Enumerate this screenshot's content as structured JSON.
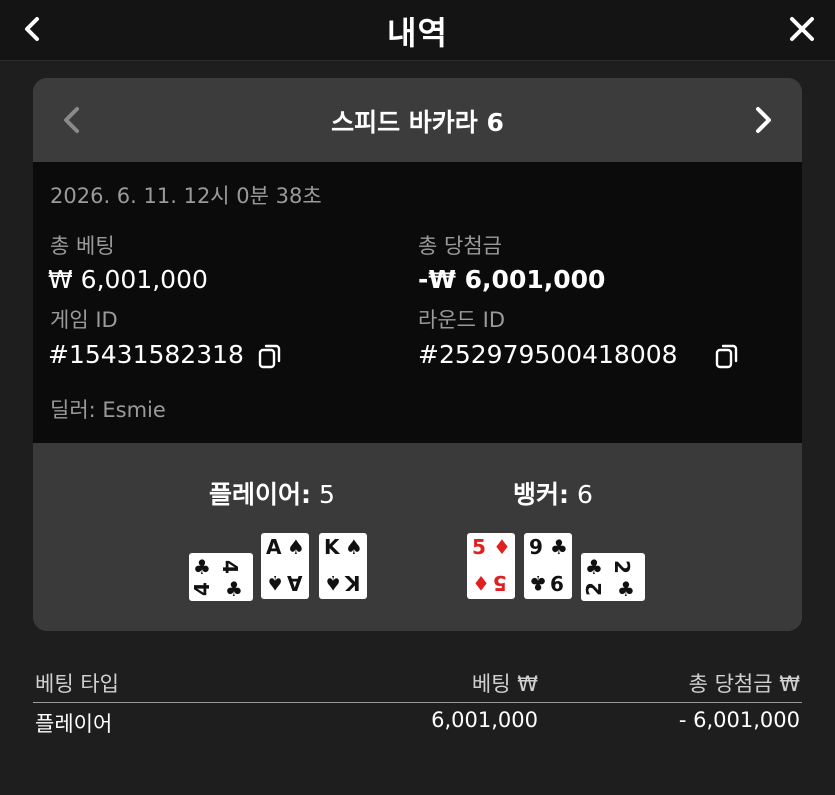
{
  "header": {
    "title": "내역",
    "back_icon": "chevron-left-icon",
    "close_icon": "close-icon"
  },
  "game": {
    "title": "스피드 바카라 6"
  },
  "details": {
    "datetime": "2026. 6. 11. 12시 0분 38초",
    "total_bet_label": "총 베팅",
    "total_bet_value": "₩ 6,001,000",
    "total_win_label": "총 당첨금",
    "total_win_value": "-₩ 6,001,000",
    "game_id_label": "게임 ID",
    "game_id_value": "#15431582318",
    "round_id_label": "라운드 ID",
    "round_id_value": "#252979500418008",
    "dealer": "딜러: Esmie"
  },
  "player": {
    "label": "플레이어:",
    "score": "5",
    "cards": [
      {
        "rank": "4",
        "suit": "♣",
        "color": "black",
        "rotated": true
      },
      {
        "rank": "A",
        "suit": "♠",
        "color": "black",
        "rotated": false
      },
      {
        "rank": "K",
        "suit": "♠",
        "color": "black",
        "rotated": false
      }
    ]
  },
  "banker": {
    "label": "뱅커:",
    "score": "6",
    "cards": [
      {
        "rank": "5",
        "suit": "♦",
        "color": "red",
        "rotated": false
      },
      {
        "rank": "9",
        "suit": "♣",
        "color": "black",
        "rotated": false
      },
      {
        "rank": "2",
        "suit": "♣",
        "color": "black",
        "rotated": true
      }
    ]
  },
  "bets_table": {
    "headers": {
      "type": "베팅 타입",
      "bet": "베팅 ₩",
      "win": "총 당첨금 ₩"
    },
    "rows": [
      {
        "type": "플레이어",
        "bet": "6,001,000",
        "win": "- 6,001,000"
      }
    ]
  },
  "colors": {
    "background": "#1e1e1e",
    "card_bg": "#3a3a3a",
    "info_bg": "#0b0b0b",
    "muted_text": "#9a9a9a",
    "red_suit": "#e02020"
  }
}
